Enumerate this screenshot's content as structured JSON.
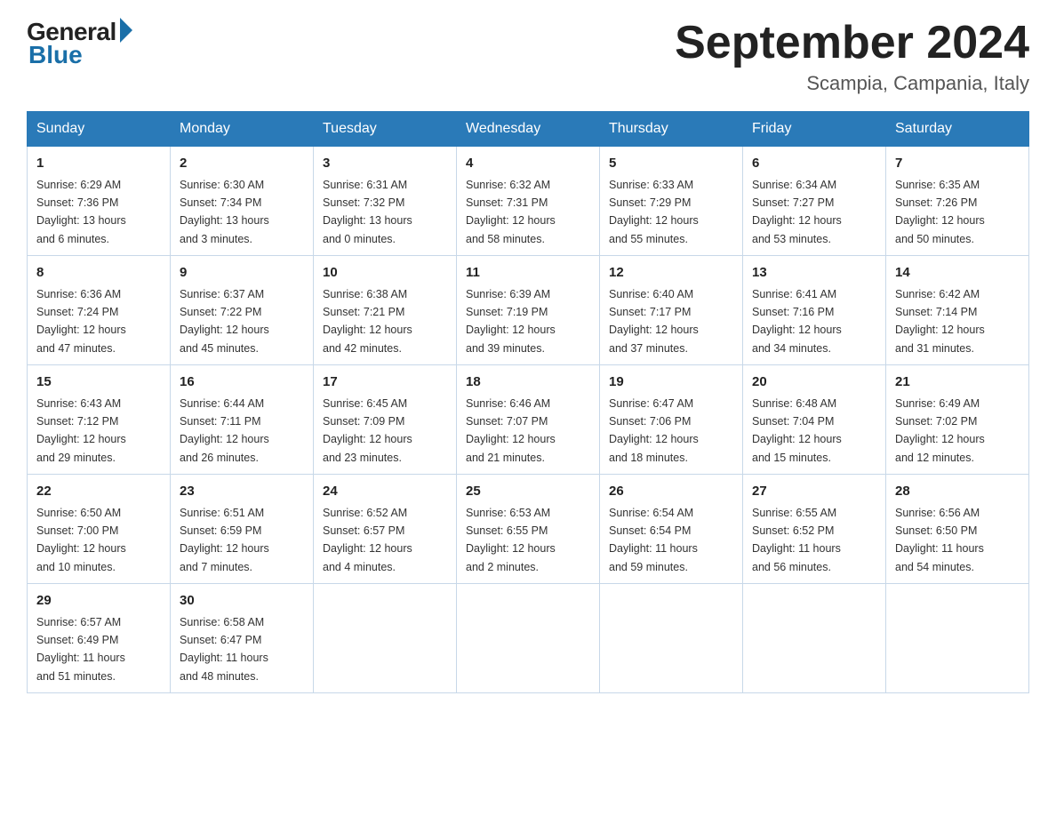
{
  "logo": {
    "general": "General",
    "blue": "Blue"
  },
  "title": "September 2024",
  "location": "Scampia, Campania, Italy",
  "headers": [
    "Sunday",
    "Monday",
    "Tuesday",
    "Wednesday",
    "Thursday",
    "Friday",
    "Saturday"
  ],
  "weeks": [
    [
      {
        "day": "1",
        "sunrise": "6:29 AM",
        "sunset": "7:36 PM",
        "daylight": "13 hours and 6 minutes."
      },
      {
        "day": "2",
        "sunrise": "6:30 AM",
        "sunset": "7:34 PM",
        "daylight": "13 hours and 3 minutes."
      },
      {
        "day": "3",
        "sunrise": "6:31 AM",
        "sunset": "7:32 PM",
        "daylight": "13 hours and 0 minutes."
      },
      {
        "day": "4",
        "sunrise": "6:32 AM",
        "sunset": "7:31 PM",
        "daylight": "12 hours and 58 minutes."
      },
      {
        "day": "5",
        "sunrise": "6:33 AM",
        "sunset": "7:29 PM",
        "daylight": "12 hours and 55 minutes."
      },
      {
        "day": "6",
        "sunrise": "6:34 AM",
        "sunset": "7:27 PM",
        "daylight": "12 hours and 53 minutes."
      },
      {
        "day": "7",
        "sunrise": "6:35 AM",
        "sunset": "7:26 PM",
        "daylight": "12 hours and 50 minutes."
      }
    ],
    [
      {
        "day": "8",
        "sunrise": "6:36 AM",
        "sunset": "7:24 PM",
        "daylight": "12 hours and 47 minutes."
      },
      {
        "day": "9",
        "sunrise": "6:37 AM",
        "sunset": "7:22 PM",
        "daylight": "12 hours and 45 minutes."
      },
      {
        "day": "10",
        "sunrise": "6:38 AM",
        "sunset": "7:21 PM",
        "daylight": "12 hours and 42 minutes."
      },
      {
        "day": "11",
        "sunrise": "6:39 AM",
        "sunset": "7:19 PM",
        "daylight": "12 hours and 39 minutes."
      },
      {
        "day": "12",
        "sunrise": "6:40 AM",
        "sunset": "7:17 PM",
        "daylight": "12 hours and 37 minutes."
      },
      {
        "day": "13",
        "sunrise": "6:41 AM",
        "sunset": "7:16 PM",
        "daylight": "12 hours and 34 minutes."
      },
      {
        "day": "14",
        "sunrise": "6:42 AM",
        "sunset": "7:14 PM",
        "daylight": "12 hours and 31 minutes."
      }
    ],
    [
      {
        "day": "15",
        "sunrise": "6:43 AM",
        "sunset": "7:12 PM",
        "daylight": "12 hours and 29 minutes."
      },
      {
        "day": "16",
        "sunrise": "6:44 AM",
        "sunset": "7:11 PM",
        "daylight": "12 hours and 26 minutes."
      },
      {
        "day": "17",
        "sunrise": "6:45 AM",
        "sunset": "7:09 PM",
        "daylight": "12 hours and 23 minutes."
      },
      {
        "day": "18",
        "sunrise": "6:46 AM",
        "sunset": "7:07 PM",
        "daylight": "12 hours and 21 minutes."
      },
      {
        "day": "19",
        "sunrise": "6:47 AM",
        "sunset": "7:06 PM",
        "daylight": "12 hours and 18 minutes."
      },
      {
        "day": "20",
        "sunrise": "6:48 AM",
        "sunset": "7:04 PM",
        "daylight": "12 hours and 15 minutes."
      },
      {
        "day": "21",
        "sunrise": "6:49 AM",
        "sunset": "7:02 PM",
        "daylight": "12 hours and 12 minutes."
      }
    ],
    [
      {
        "day": "22",
        "sunrise": "6:50 AM",
        "sunset": "7:00 PM",
        "daylight": "12 hours and 10 minutes."
      },
      {
        "day": "23",
        "sunrise": "6:51 AM",
        "sunset": "6:59 PM",
        "daylight": "12 hours and 7 minutes."
      },
      {
        "day": "24",
        "sunrise": "6:52 AM",
        "sunset": "6:57 PM",
        "daylight": "12 hours and 4 minutes."
      },
      {
        "day": "25",
        "sunrise": "6:53 AM",
        "sunset": "6:55 PM",
        "daylight": "12 hours and 2 minutes."
      },
      {
        "day": "26",
        "sunrise": "6:54 AM",
        "sunset": "6:54 PM",
        "daylight": "11 hours and 59 minutes."
      },
      {
        "day": "27",
        "sunrise": "6:55 AM",
        "sunset": "6:52 PM",
        "daylight": "11 hours and 56 minutes."
      },
      {
        "day": "28",
        "sunrise": "6:56 AM",
        "sunset": "6:50 PM",
        "daylight": "11 hours and 54 minutes."
      }
    ],
    [
      {
        "day": "29",
        "sunrise": "6:57 AM",
        "sunset": "6:49 PM",
        "daylight": "11 hours and 51 minutes."
      },
      {
        "day": "30",
        "sunrise": "6:58 AM",
        "sunset": "6:47 PM",
        "daylight": "11 hours and 48 minutes."
      },
      null,
      null,
      null,
      null,
      null
    ]
  ],
  "labels": {
    "sunrise": "Sunrise:",
    "sunset": "Sunset:",
    "daylight": "Daylight:"
  }
}
